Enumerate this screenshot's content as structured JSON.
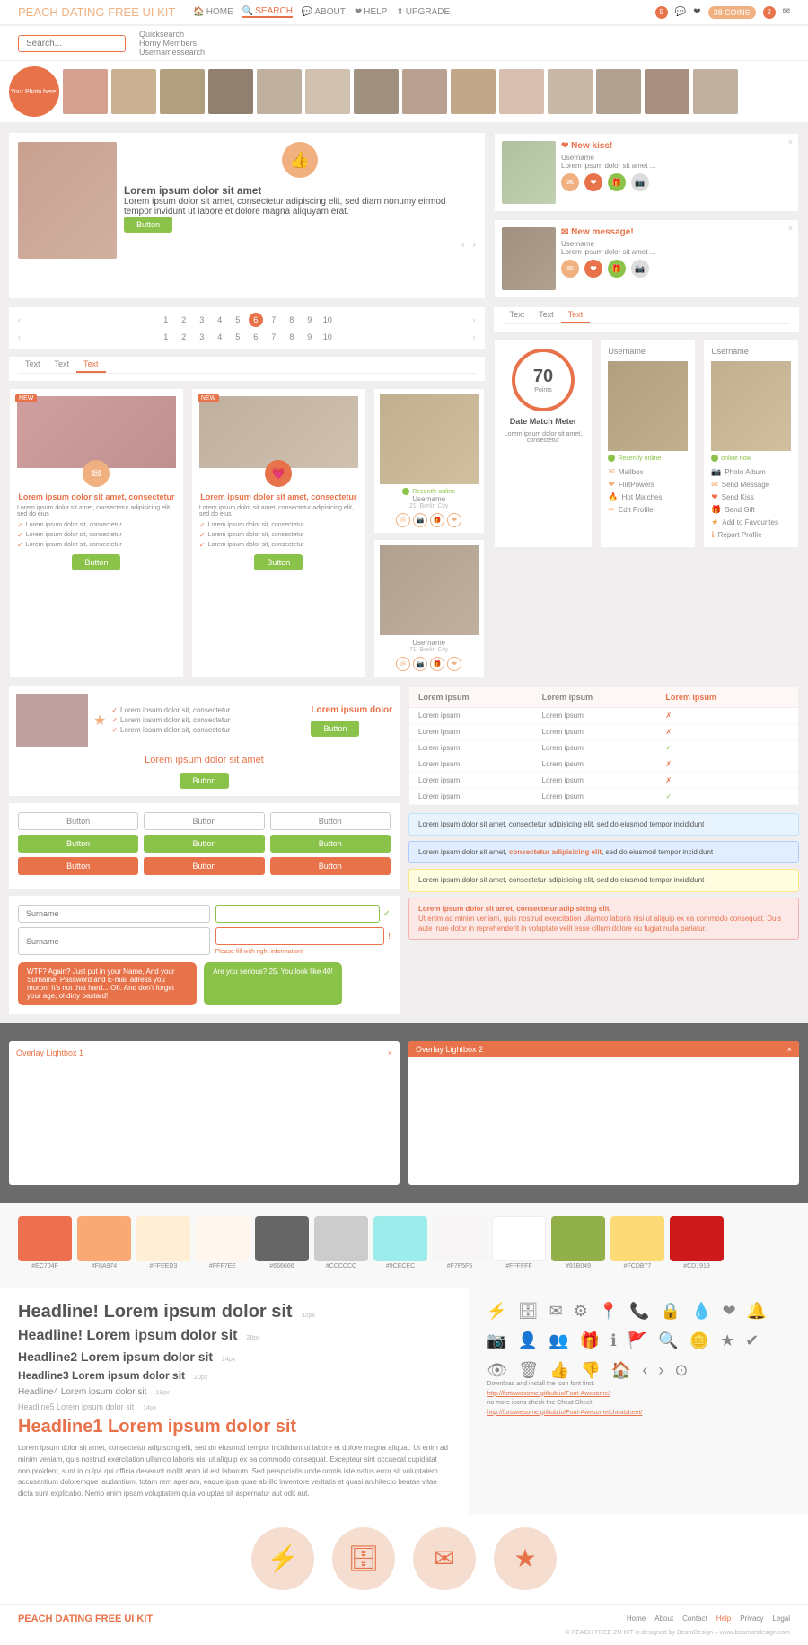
{
  "nav": {
    "logo": "PEACH DATING",
    "logo_free": "FREE",
    "logo_kit": "UI KIT",
    "links": [
      "HOME",
      "SEARCH",
      "ABOUT",
      "HELP",
      "UPGRADE"
    ],
    "active_link": "SEARCH",
    "coins": "38 COINS",
    "badge1": "5",
    "badge2": "2"
  },
  "search": {
    "placeholder": "Search...",
    "quicksearch": "Quicksearch",
    "horny_members": "Horny Members",
    "username_search": "Usernamessearch"
  },
  "hero": {
    "title": "Lorem ipsum dolor sit amet",
    "body": "Lorem ipsum dolor sit amet, consectetur adipiscing elit, sed diam nonumy eirmod tempor invidunt ut labore et dolore magna aliquyam erat.",
    "button": "Button",
    "notif1_title": "New kiss!",
    "notif1_user": "Username",
    "notif1_text": "Lorem ipsum dolor sit amet ...",
    "notif2_title": "New message!",
    "notif2_user": "Username",
    "notif2_text": "Lorem ipsum dolor sit amet ..."
  },
  "profiles": {
    "card1_title": "Lorem ipsum dolor sit amet, consectetur",
    "card1_desc": "Lorem ipsum dolor sit amet, consectetur adipisicing elit, sed do eius",
    "card1_check1": "Lorem ipsum dolor sit, consectetur",
    "card1_check2": "Lorem ipsum dolor sit, consectetur",
    "card1_check3": "Lorem ipsum dolor sit, consectetur",
    "card2_title": "Lorem ipsum dolor sit amet, consectetur",
    "card2_desc": "Lorem ipsum dolor sit amet, consectetur adipisicing elit, sed do eius",
    "button": "Button"
  },
  "pagination": {
    "pages": [
      "1",
      "2",
      "3",
      "4",
      "5",
      "6",
      "7",
      "8",
      "9",
      "10"
    ],
    "active": "6"
  },
  "tabs": [
    "Text",
    "Text",
    "Text"
  ],
  "active_tab": "Text",
  "date_match": {
    "points": "70",
    "points_label": "Points",
    "title": "Date Match Meter",
    "desc": "Lorem ipsum dolor sit amet, consectetur"
  },
  "user_profile": {
    "label": "Username",
    "name": "Username",
    "online": "Recently online",
    "online2": "online now",
    "actions": [
      "Mailbox",
      "FlirtPowers",
      "Hot Matches",
      "Edit Profile",
      "Photo Album",
      "Send Message",
      "Send Kiss",
      "Send Gift",
      "Add to Favourites",
      "Report Profile"
    ]
  },
  "match_profiles": [
    {
      "username": "Username",
      "city": "21, Berlin City"
    },
    {
      "username": "Username",
      "city": "71, Berlin City"
    }
  ],
  "featured": {
    "title": "Lorem ipsum dolor",
    "button": "Button",
    "checks": [
      "Lorem ipsum dolor sit, consectetur",
      "Lorem ipsum dolor sit, consectetur",
      "Lorem ipsum dolor sit, consectetur"
    ],
    "section_title": "Lorem ipsum dolor sit amet",
    "section_button": "Button"
  },
  "buttons": {
    "outline": "Button",
    "green": "Button",
    "orange": "Button"
  },
  "form": {
    "placeholder1": "Surname",
    "placeholder2": "Surname",
    "error_msg": "Please fill with right information!",
    "bubble_left": "WTF? Again? Just put in your Name, And your Surname, Password and E-mail adress you moron! It's not that hard... Oh. And don't forget your age, ol dirty bastard!",
    "bubble_right": "Are you serious? 25. You look like 40!"
  },
  "comparison": {
    "headers": [
      "Lorem ipsum",
      "Lorem ipsum",
      "Lorem ipsum"
    ],
    "rows": [
      [
        "Lorem ipsum",
        "Lorem ipsum",
        "x"
      ],
      [
        "Lorem ipsum",
        "Lorem ipsum",
        "x"
      ],
      [
        "Lorem ipsum",
        "Lorem ipsum",
        "check"
      ],
      [
        "Lorem ipsum",
        "Lorem ipsum",
        "x"
      ],
      [
        "Lorem ipsum",
        "Lorem ipsum",
        "x"
      ],
      [
        "Lorem ipsum",
        "Lorem ipsum",
        "check"
      ]
    ]
  },
  "alerts": {
    "info": "Lorem ipsum dolor sit amet, consectetur adipisicing elit, sed do eiusmod tempor incididunt",
    "blue": "Lorem ipsum dolor sit amet, consectetur adipisicing elit, sed do eiusmod tempor incididunt",
    "yellow": "Lorem ipsum dolor sit amet, consectetur adipisicing elit, sed do eiusmod tempor incididunt",
    "red_title": "Lorem ipsum dolor sit amet, consectetur adipisicing elit.",
    "red_body": "Ut enim ad minim veniam, quis nostrud exercitation ullamco laboris nisi ut aliquip ex ea commodo consequat. Duis aute irure dolor in reprehenderit in voluptate velit esse cillum dolore eu fugiat nulla pariatur."
  },
  "overlays": {
    "title1": "Overlay Lightbox 1",
    "title2": "Overlay Lightbox 2"
  },
  "swatches": [
    {
      "color": "#EC704F",
      "label": "#EC704F"
    },
    {
      "color": "#F8A974",
      "label": "#F8A974"
    },
    {
      "color": "#FFEED3",
      "label": "#FFEED3"
    },
    {
      "color": "#FFF7EE",
      "label": "#FFF7EE"
    },
    {
      "color": "#666666",
      "label": "#666666"
    },
    {
      "color": "#CCCCCC",
      "label": "#CCCCCC"
    },
    {
      "color": "#9CECEC",
      "label": "#9CECEC"
    },
    {
      "color": "#F7F5F5",
      "label": "#F7F5F5"
    },
    {
      "color": "#FFFFFF",
      "label": "#FFFFFF"
    },
    {
      "color": "#91B049",
      "label": "#91B049"
    },
    {
      "color": "#FCDB77",
      "label": "#FCDB77"
    },
    {
      "color": "#CD1919",
      "label": "#CD1919"
    }
  ],
  "typography": {
    "h1": "Headline! Lorem ipsum dolor sit",
    "h1_size": "32px",
    "h2": "Headline! Lorem ipsum dolor sit",
    "h2_size": "28px",
    "h3": "Headline2 Lorem ipsum dolor sit",
    "h3_size": "24px",
    "h4": "Headline3 Lorem ipsum dolor sit",
    "h4_size": "20px",
    "h5": "Headline4 Lorem ipsum dolor sit",
    "h5_size": "18px",
    "h6": "Headline5 Lorem ipsum dolor sit",
    "h6_size": "14px",
    "h1_orange": "Headline1 Lorem ipsum dolor sit",
    "body_text": "Lorem ipsum dolor sit amet, consectetur adipiscing elit, sed do eiusmod tempor incididunt ut labore et dolore magna aliquat. Ut enim ad minim veniam, quis nostrud exercitation ullamco laboris nisi ut aliquip ex ea commodo consequat. Excepteur sint occaecat cupidatat non proident, sunt in culpa qui officia deserunt mollit anim id est laborum. Sed perspiciatis unde omnis iste natus error sit voluptatem accusantium doloremque laudantium, totam rem aperiam, eaque ipsa quae ab illo inventore veritatis et quasi architecto beatae vitae dicta sunt explicabo. Nemo enim ipsam voluptatem quia voluptas sit aspernatur aut odit aut."
  },
  "icons": {
    "note_title": "Download and install the icon font first:",
    "note_url1": "http://fortawesome.github.io/Font-Awesome/",
    "note_text": "no more icons check the Cheat Sheet:",
    "note_url2": "http://fortawesome.github.io/Font-Awesome/cheatsheet/"
  },
  "footer": {
    "logo": "PEACH DATING FREE UI KIT",
    "links": [
      "Home",
      "About",
      "Contact",
      "Help",
      "Privacy",
      "Legal"
    ],
    "active_link": "Help",
    "copyright": "© PEACH FREE ZU KIT is designed by BeamDesign – www.beamartdesign.com"
  }
}
